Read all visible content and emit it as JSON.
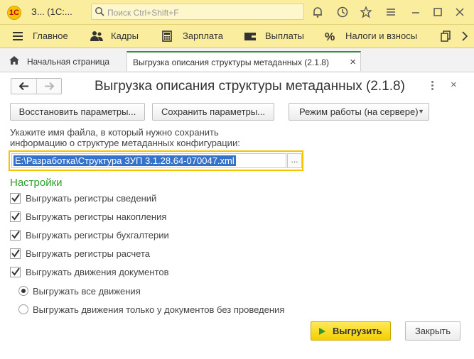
{
  "titlebar": {
    "logo_text": "1С",
    "title": "З...  (1С:...",
    "search_placeholder": "Поиск Ctrl+Shift+F"
  },
  "menu": {
    "items": [
      {
        "label": "Главное",
        "icon": "hamburger-icon"
      },
      {
        "label": "Кадры",
        "icon": "people-icon"
      },
      {
        "label": "Зарплата",
        "icon": "calculator-icon"
      },
      {
        "label": "Выплаты",
        "icon": "wallet-icon"
      },
      {
        "label": "Налоги и взносы",
        "icon": "percent-icon"
      }
    ]
  },
  "tabs": {
    "home": "Начальная страница",
    "active": "Выгрузка описания структуры метаданных (2.1.8)",
    "close_glyph": "×"
  },
  "form": {
    "title": "Выгрузка описания структуры метаданных (2.1.8)",
    "close_glyph": "×",
    "buttons": {
      "restore": "Восстановить параметры...",
      "save": "Сохранить параметры...",
      "mode": "Режим работы (на сервере)",
      "export": "Выгрузить",
      "close": "Закрыть"
    },
    "hint_line1": "Укажите имя файла, в который нужно сохранить",
    "hint_line2": "информацию о структуре метаданных конфигурации:",
    "file_path": "E:\\Разработка\\Структура ЗУП 3.1.28.64-070047.xml",
    "file_choose": "...",
    "settings_title": "Настройки",
    "checkboxes": [
      {
        "label": "Выгружать регистры сведений",
        "checked": true
      },
      {
        "label": "Выгружать регистры накопления",
        "checked": true
      },
      {
        "label": "Выгружать регистры бухгалтерии",
        "checked": true
      },
      {
        "label": "Выгружать регистры расчета",
        "checked": true
      },
      {
        "label": "Выгружать движения документов",
        "checked": true
      }
    ],
    "radios": [
      {
        "label": "Выгружать все движения",
        "selected": true
      },
      {
        "label": "Выгружать движения только у документов без проведения",
        "selected": false
      }
    ]
  },
  "colors": {
    "panel_yellow": "#fbed9e",
    "accent_yellow": "#f5c400",
    "settings_green": "#2ca02c",
    "selection_blue": "#3572c9"
  }
}
